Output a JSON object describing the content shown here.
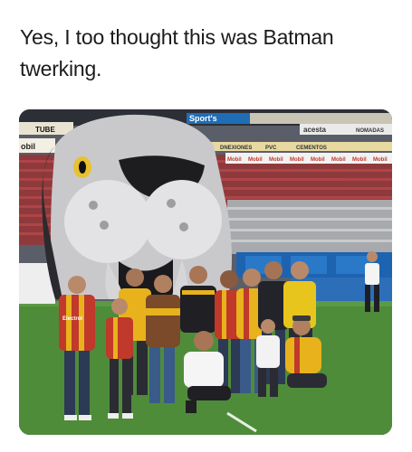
{
  "post": {
    "caption_line1": "Yes, I too thought this was Batman",
    "caption_line2": "twerking."
  },
  "photo": {
    "signage": {
      "top_left": "TUBE",
      "left_board": "obil",
      "upper_board": "Sport's",
      "band_1": "DNEXIONES",
      "band_2": "PVC",
      "band_3": "CEMENTOS",
      "right_board": "acesta",
      "right_board_2": "NOMADAS",
      "mobil_repeat": [
        "Mobil",
        "Mobil",
        "Mobil",
        "Mobil",
        "Mobil",
        "Mobil",
        "Mobil",
        "Mobil"
      ],
      "jersey_text": "Electrol"
    },
    "colors": {
      "grass": "#4f8c3a",
      "seats": "#a23b3b",
      "mascot": "#c9c9cc",
      "jersey_red": "#c0392b",
      "jersey_yellow": "#e8b21c"
    }
  }
}
